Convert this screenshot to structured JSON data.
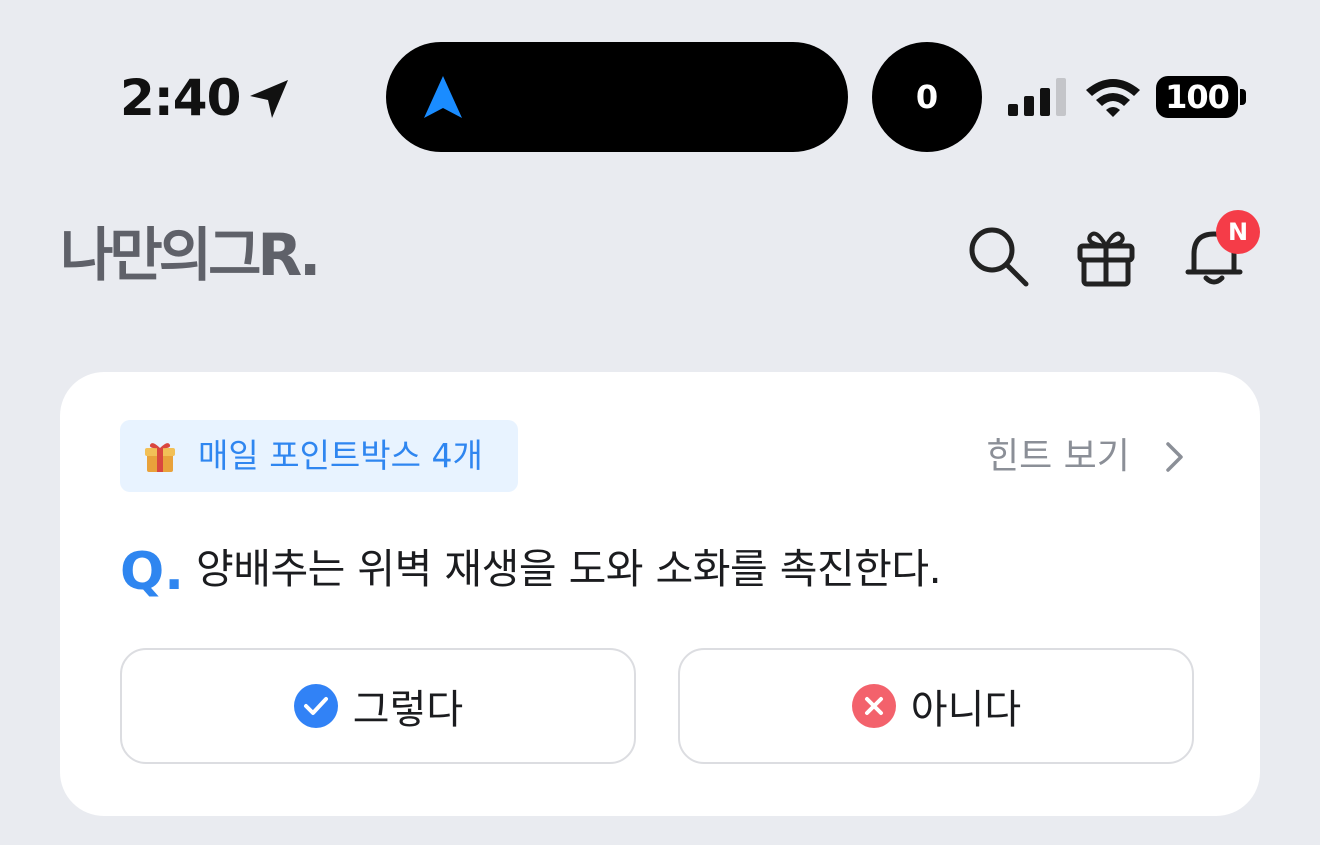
{
  "status_bar": {
    "time": "2:40",
    "indicator_count": "0",
    "battery": "100"
  },
  "header": {
    "logo": "나만의그R.",
    "notification_badge": "N"
  },
  "quiz": {
    "points_label": "매일 포인트박스 4개",
    "hint_label": "힌트 보기",
    "q_prefix": "Q.",
    "question": "양배추는 위벽 재생을 도와 소화를 촉진한다.",
    "choices": [
      {
        "label": "그렇다",
        "icon": "check-circle-icon",
        "color": "#3182f6"
      },
      {
        "label": "아니다",
        "icon": "x-circle-icon",
        "color": "#f3626c"
      }
    ]
  },
  "colors": {
    "accent": "#2f86f0",
    "badge": "#f53c48",
    "background": "#e9ebf0"
  }
}
